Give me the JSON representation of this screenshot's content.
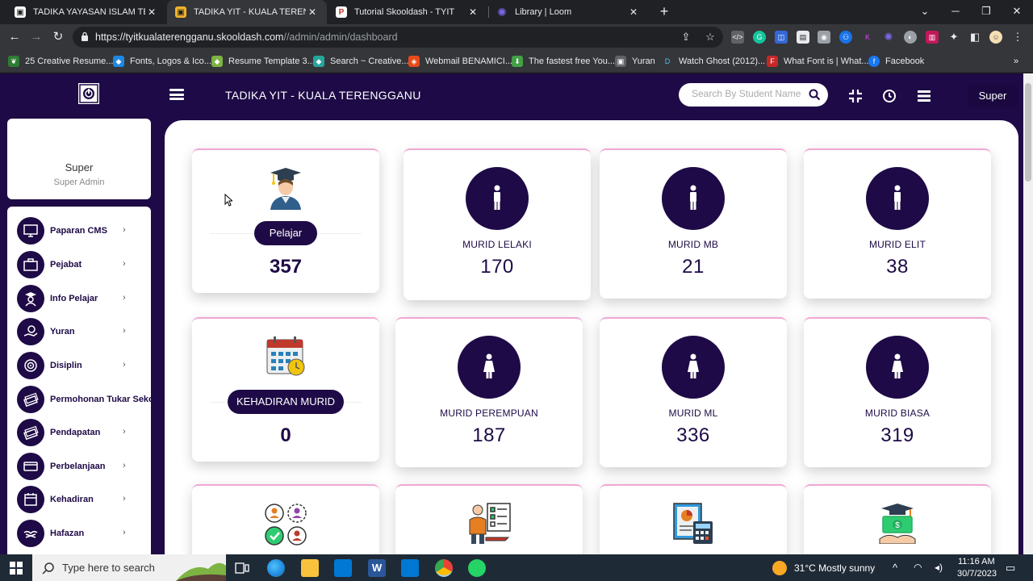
{
  "browser": {
    "tabs": [
      {
        "title": "TADIKA YAYASAN ISLAM TERENGG",
        "active": false
      },
      {
        "title": "TADIKA YIT - KUALA TERENGGANU",
        "active": true
      },
      {
        "title": "Tutorial Skooldash - TYIT",
        "active": false
      },
      {
        "title": "Library | Loom",
        "active": false
      }
    ],
    "url_host": "https://tyitkualaterengganu.skooldash.com",
    "url_path": "//admin/admin/dashboard",
    "bookmarks": [
      "25 Creative Resume...",
      "Fonts, Logos & Ico...",
      "Resume Template 3...",
      "Search ~ Creative...",
      "Webmail BENAMICI...",
      "The fastest free You...",
      "Yuran",
      "Watch Ghost (2012)...",
      "What Font is | What...",
      "Facebook"
    ]
  },
  "header": {
    "school_title": "TADIKA YIT - KUALA TERENGGANU",
    "search_placeholder": "Search By Student Name",
    "user_name": "Super"
  },
  "profile": {
    "name": "Super",
    "role": "Super Admin"
  },
  "sidebar": {
    "items": [
      {
        "label": "Paparan CMS"
      },
      {
        "label": "Pejabat"
      },
      {
        "label": "Info Pelajar"
      },
      {
        "label": "Yuran"
      },
      {
        "label": "Disiplin"
      },
      {
        "label": "Permohonan Tukar Seko"
      },
      {
        "label": "Pendapatan"
      },
      {
        "label": "Perbelanjaan"
      },
      {
        "label": "Kehadiran"
      },
      {
        "label": "Hafazan"
      }
    ]
  },
  "dashboard": {
    "pelajar": {
      "label": "Pelajar",
      "value": "357"
    },
    "murid_lelaki": {
      "label": "MURID LELAKI",
      "value": "170"
    },
    "murid_mb": {
      "label": "MURID MB",
      "value": "21"
    },
    "murid_elit": {
      "label": "MURID ELIT",
      "value": "38"
    },
    "kehadiran_murid": {
      "label": "KEHADIRAN MURID",
      "value": "0"
    },
    "murid_perempuan": {
      "label": "MURID PEREMPUAN",
      "value": "187"
    },
    "murid_ml": {
      "label": "MURID ML",
      "value": "336"
    },
    "murid_biasa": {
      "label": "MURID BIASA",
      "value": "319"
    }
  },
  "taskbar": {
    "search_text": "Type here to search",
    "weather": "31°C  Mostly sunny",
    "time": "11:16 AM",
    "date": "30/7/2023"
  },
  "colors": {
    "brand": "#1e0a46",
    "accent_border": "#f1a7d4"
  }
}
